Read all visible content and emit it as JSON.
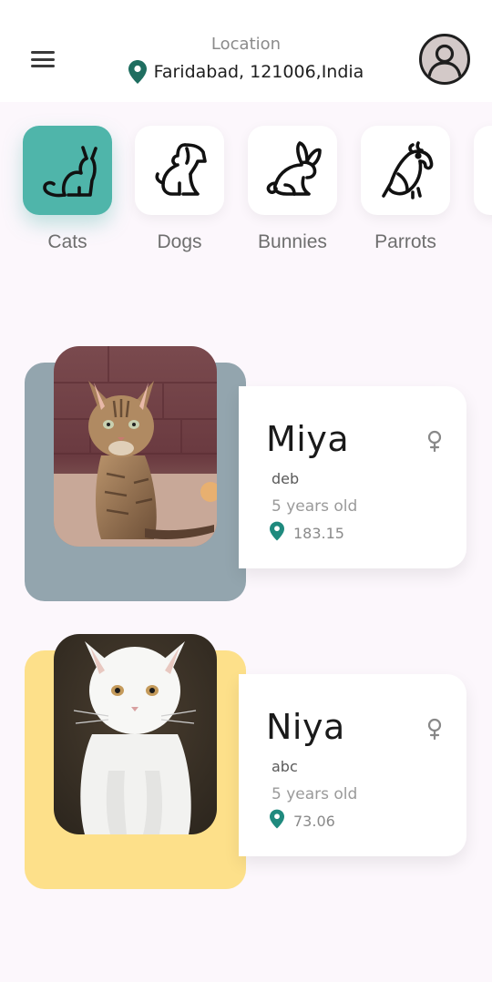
{
  "header": {
    "location_caption": "Location",
    "location_value": "Faridabad, 121006,India",
    "menu_icon": "hamburger-menu-icon",
    "pin_icon": "map-pin-icon",
    "avatar_icon": "user-avatar-icon"
  },
  "categories": [
    {
      "label": "Cats",
      "icon": "cat-icon",
      "active": true
    },
    {
      "label": "Dogs",
      "icon": "dog-icon",
      "active": false
    },
    {
      "label": "Bunnies",
      "icon": "bunny-icon",
      "active": false
    },
    {
      "label": "Parrots",
      "icon": "parrot-icon",
      "active": false
    }
  ],
  "pets": [
    {
      "name": "Miya",
      "breed": "deb",
      "age": "5 years old",
      "distance": "183.15",
      "gender_icon": "female-icon",
      "backdrop_color": "#93a5ae"
    },
    {
      "name": "Niya",
      "breed": "abc",
      "age": "5 years old",
      "distance": "73.06",
      "gender_icon": "female-icon",
      "backdrop_color": "#fde08a"
    }
  ],
  "colors": {
    "accent": "#4fb5aa",
    "pin": "#1f8a7e",
    "background": "#fcf7fc"
  }
}
